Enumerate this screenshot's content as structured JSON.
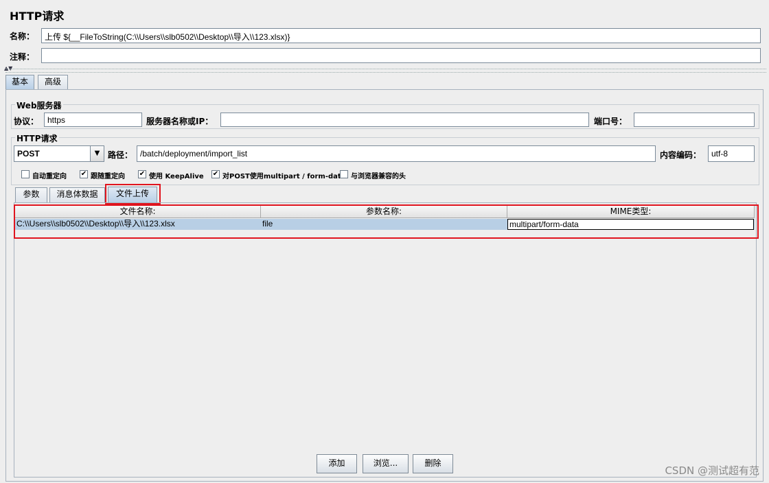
{
  "title": "HTTP请求",
  "name_label": "名称：",
  "name_value": "上传 ${__FileToString(C:\\\\Users\\\\slb0502\\\\Desktop\\\\导入\\\\123.xlsx)}",
  "comment_label": "注释：",
  "comment_value": "",
  "top_tabs": [
    "基本",
    "高级"
  ],
  "web_server": {
    "group_title": "Web服务器",
    "protocol_label": "协议：",
    "protocol_value": "https",
    "server_label": "服务器名称或IP：",
    "server_value": "",
    "port_label": "端口号：",
    "port_value": ""
  },
  "http_request": {
    "group_title": "HTTP请求",
    "method": "POST",
    "path_label": "路径：",
    "path_value": "/batch/deployment/import_list",
    "encoding_label": "内容编码：",
    "encoding_value": "utf-8"
  },
  "checkboxes": [
    {
      "label": "自动重定向",
      "checked": false
    },
    {
      "label": "跟随重定向",
      "checked": true
    },
    {
      "label": "使用 KeepAlive",
      "checked": true
    },
    {
      "label": "对POST使用multipart / form-data",
      "checked": true
    },
    {
      "label": "与浏览器兼容的头",
      "checked": false
    }
  ],
  "sub_tabs": [
    "参数",
    "消息体数据",
    "文件上传"
  ],
  "table": {
    "headers": [
      "文件名称:",
      "参数名称:",
      "MIME类型:"
    ],
    "rows": [
      [
        "C:\\\\Users\\\\slb0502\\\\Desktop\\\\导入\\\\123.xlsx",
        "file",
        "multipart/form-data"
      ]
    ]
  },
  "buttons": {
    "add": "添加",
    "browse": "浏览...",
    "delete": "删除"
  },
  "watermark": "CSDN @测试超有范",
  "colors": {
    "highlight_red": "#e0141e",
    "selection": "#b8cfe5",
    "background": "#eeeeee"
  }
}
